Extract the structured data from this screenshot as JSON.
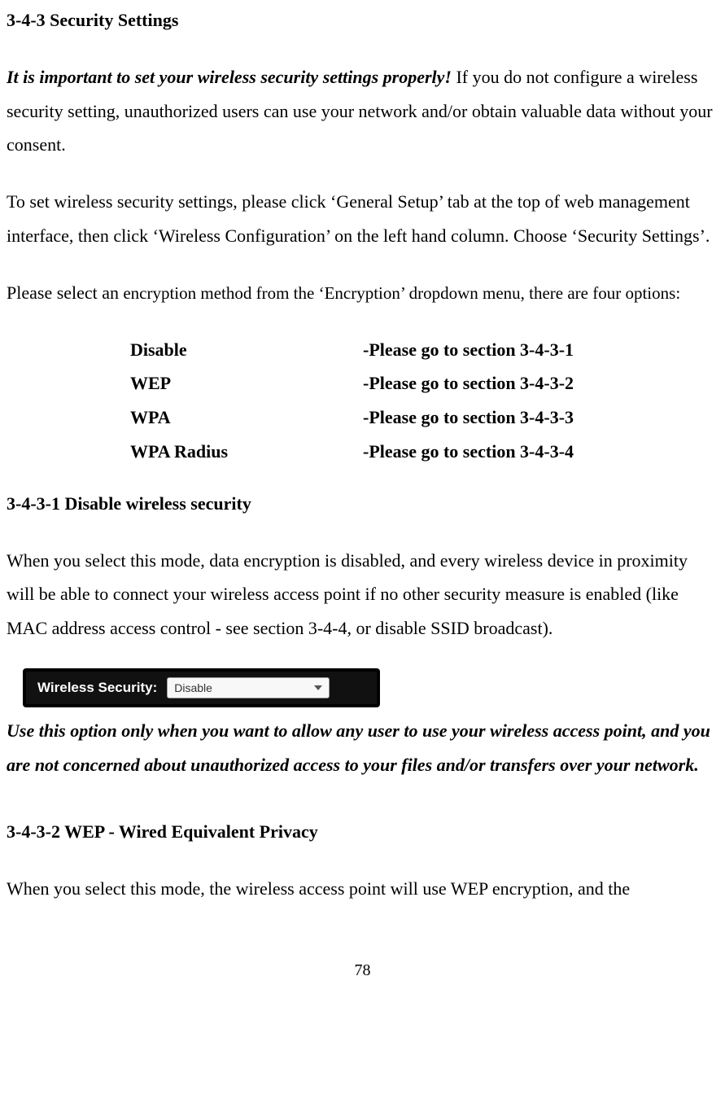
{
  "sec_main_heading": "3-4-3 Security Settings",
  "intro_emph": "It is important to set your wireless security settings properly!",
  "intro_rest": " If you do not configure a wireless security setting, unauthorized users can use your network and/or obtain valuable data without your consent.",
  "p2": "To set wireless security settings, please click ‘General Setup’ tab at the top of web management interface, then click ‘Wireless Configuration’ on the left hand column. Choose ‘Security Settings’.",
  "p3_a": "Please select an",
  "p3_b": " encryption method from the ‘Encryption’ dropdown menu, there are four options:",
  "options": [
    {
      "name": "Disable",
      "ref": "-Please go to section 3-4-3-1"
    },
    {
      "name": "WEP",
      "ref": "-Please go to section 3-4-3-2"
    },
    {
      "name": "WPA",
      "ref": "-Please go to section 3-4-3-3"
    },
    {
      "name": "WPA Radius",
      "ref": "-Please go to section 3-4-3-4"
    }
  ],
  "sec_3431_heading": "3-4-3-1 Disable wireless security",
  "sec_3431_p1": "When you select this mode, data encryption is disabled, and every wireless device in proximity will be able to connect your wireless access point if no other security measure is enabled (like MAC address access control - see section 3-4-4, or disable SSID broadcast).",
  "widget": {
    "label": "Wireless Security:",
    "value": "Disable"
  },
  "sec_3431_warn": "Use this option only when you want to allow any user to use your wireless access point, and you are not concerned about unauthorized access to your files and/or transfers over your network.",
  "sec_3432_heading": "3-4-3-2 WEP - Wired Equivalent Privacy",
  "sec_3432_p1": "When you select this mode, the wireless access point will use WEP encryption, and the",
  "page_number": "78"
}
